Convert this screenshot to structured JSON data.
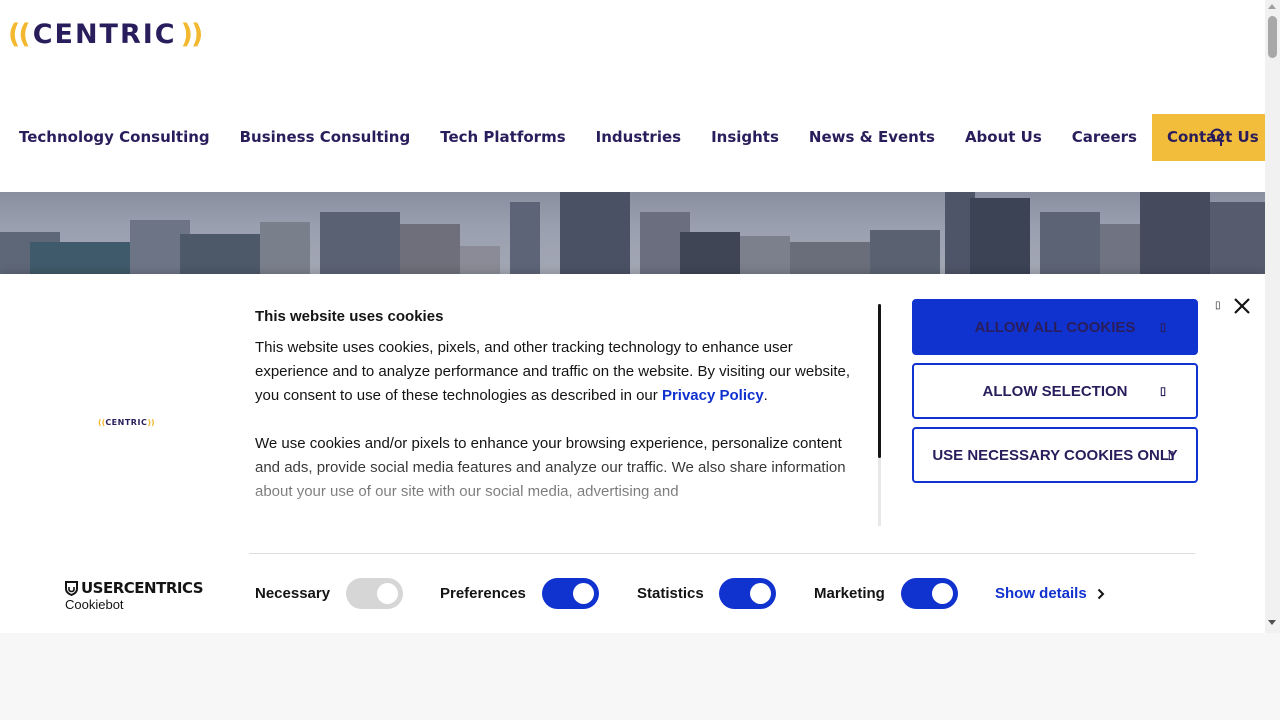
{
  "header": {
    "logo": {
      "left": "((",
      "word": "CENTRIC",
      "right": "))"
    },
    "nav": [
      {
        "label": "Technology Consulting",
        "name": "nav-technology-consulting"
      },
      {
        "label": "Business Consulting",
        "name": "nav-business-consulting"
      },
      {
        "label": "Tech Platforms",
        "name": "nav-tech-platforms"
      },
      {
        "label": "Industries",
        "name": "nav-industries"
      },
      {
        "label": "Insights",
        "name": "nav-insights"
      },
      {
        "label": "News & Events",
        "name": "nav-news-events"
      },
      {
        "label": "About Us",
        "name": "nav-about-us"
      },
      {
        "label": "Careers",
        "name": "nav-careers"
      }
    ],
    "cta_label": "Contact Us",
    "search_icon": "search-icon"
  },
  "cookie": {
    "logo": {
      "left": "((",
      "word": "CENTRIC",
      "right": "))"
    },
    "title": "This website uses cookies",
    "para1_before": "This website uses cookies, pixels, and other tracking technology to enhance user experience and to analyze performance and traffic on the website. By visiting our website, you consent to use of these technologies as described in our ",
    "para1_link": "Privacy Policy",
    "para1_after": ".",
    "para2": "We use cookies and/or pixels to enhance your browsing experience, personalize content and ads, provide social media features and analyze our traffic. We also share information about your use of our site with our social media, advertising and",
    "buttons": {
      "allow_all": "ALLOW ALL COOKIES",
      "allow_selection": "ALLOW SELECTION",
      "necessary_only": "USE NECESSARY COOKIES ONLY"
    },
    "toggles": [
      {
        "label": "Necessary",
        "checked": true,
        "disabled": true
      },
      {
        "label": "Preferences",
        "checked": true,
        "disabled": false
      },
      {
        "label": "Statistics",
        "checked": true,
        "disabled": false
      },
      {
        "label": "Marketing",
        "checked": true,
        "disabled": false
      }
    ],
    "show_details": "Show details",
    "brand": {
      "name": "USERCENTRICS",
      "product": "Cookiebot"
    }
  },
  "colors": {
    "brand_navy": "#2a1d5c",
    "brand_yellow": "#f2bd3a",
    "cookie_blue": "#1032cf"
  }
}
